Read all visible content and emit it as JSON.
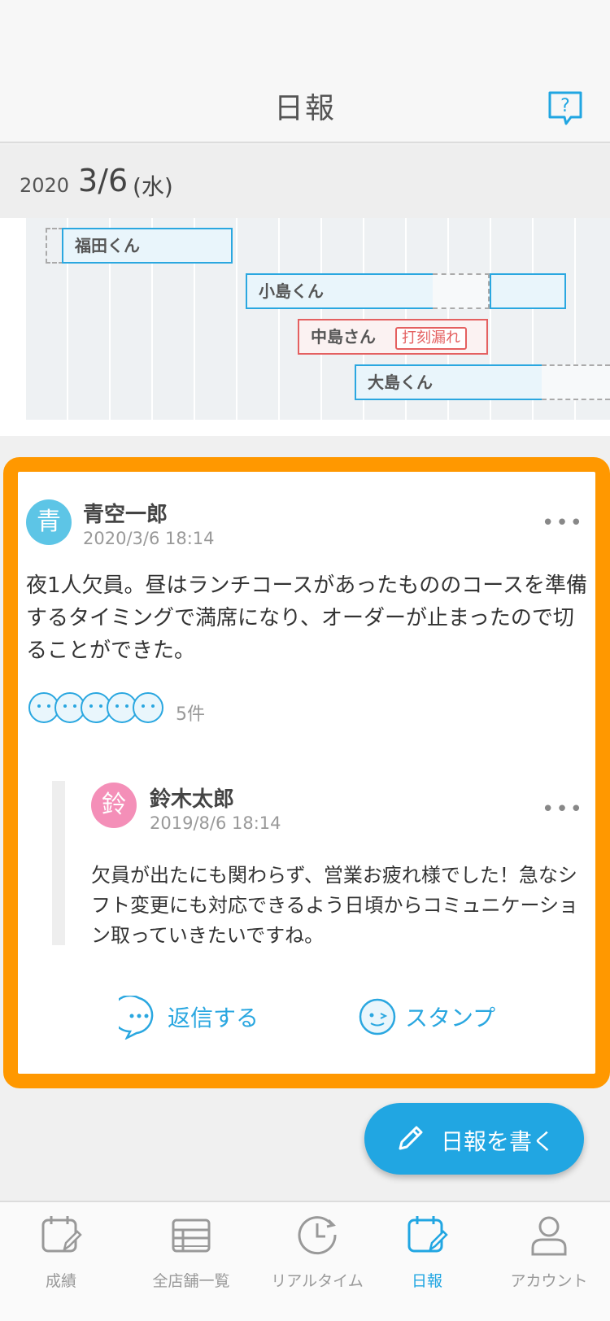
{
  "header": {
    "title": "日報"
  },
  "date": {
    "year": "2020",
    "day": "3/6",
    "weekday": "(水)"
  },
  "timeline": {
    "shifts": [
      {
        "name": "福田くん"
      },
      {
        "name": "小島くん"
      },
      {
        "name": "中島さん",
        "tag": "打刻漏れ"
      },
      {
        "name": "大島くん"
      }
    ]
  },
  "post": {
    "avatar_char": "青",
    "avatar_color": "#5dc5e6",
    "author": "青空一郎",
    "timestamp": "2020/3/6 18:14",
    "more": "•••",
    "body": "夜1人欠員。昼はランチコースがあったもののコースを準備するタイミングで満席になり、オーダーが止まったので切ることができた。",
    "reaction_count": "5件"
  },
  "reply": {
    "avatar_char": "鈴",
    "avatar_color": "#f48fb8",
    "author": "鈴木太郎",
    "timestamp": "2019/8/6 18:14",
    "more": "•••",
    "body": "欠員が出たにも関わらず、営業お疲れ様でした！急なシフト変更にも対応できるよう日頃からコミュニケーション取っていきたいですね。"
  },
  "actions": {
    "reply_label": "返信する",
    "stamp_label": "スタンプ"
  },
  "fab": {
    "label": "日報を書く"
  },
  "tabs": [
    {
      "label": "成績",
      "icon": "calendar-edit-icon",
      "active": false
    },
    {
      "label": "全店舗一覧",
      "icon": "list-icon",
      "active": false
    },
    {
      "label": "リアルタイム",
      "icon": "clock-icon",
      "active": false
    },
    {
      "label": "日報",
      "icon": "calendar-edit-icon",
      "active": true
    },
    {
      "label": "アカウント",
      "icon": "person-icon",
      "active": false
    }
  ],
  "colors": {
    "accent": "#21a6e2",
    "highlight_frame": "#ff9800",
    "error": "#e46060"
  }
}
